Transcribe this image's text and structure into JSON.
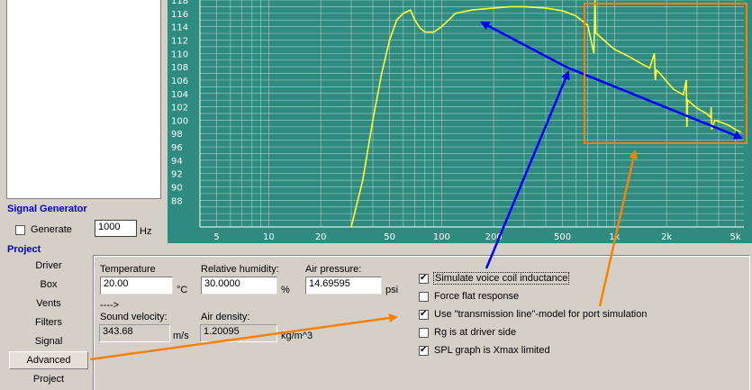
{
  "signal_generator": {
    "title": "Signal Generator",
    "generate_label": "Generate",
    "generate_checked": false,
    "frequency_value": "1000",
    "frequency_unit": "Hz"
  },
  "project_nav": {
    "title": "Project",
    "items": [
      "Driver",
      "Box",
      "Vents",
      "Filters",
      "Signal",
      "Advanced",
      "Project"
    ],
    "active": "Advanced"
  },
  "advanced": {
    "temperature": {
      "label": "Temperature",
      "value": "20.00",
      "unit": "°C"
    },
    "humidity": {
      "label": "Relative humidity:",
      "value": "30.0000",
      "unit": "%"
    },
    "pressure": {
      "label": "Air pressure:",
      "value": "14.69595",
      "unit": "psi"
    },
    "arrow_text": "---->",
    "sound_velocity": {
      "label": "Sound velocity:",
      "value": "343.68",
      "unit": "m/s"
    },
    "air_density": {
      "label": "Air density:",
      "value": "1.20095",
      "unit": "kg/m^3"
    },
    "options": [
      {
        "label": "Simulate voice coil inductance",
        "checked": true
      },
      {
        "label": "Force flat response",
        "checked": false
      },
      {
        "label": "Use \"transmission line\"-model for port simulation",
        "checked": true
      },
      {
        "label": "Rg is at driver side",
        "checked": false
      },
      {
        "label": "SPL graph is Xmax limited",
        "checked": true
      }
    ]
  },
  "colors": {
    "chart_bg": "#2f8a7f",
    "grid": "#a9d7cf",
    "curve": "#ffff33",
    "blue_annotation": "#0000ff",
    "orange_annotation": "#ff8000",
    "section_title": "#0000c0"
  },
  "chart_data": {
    "type": "line",
    "x_scale": "log",
    "xlim": [
      4,
      5600
    ],
    "ylim": [
      84,
      118
    ],
    "x_tick_labels": [
      "5",
      "10",
      "20",
      "50",
      "100",
      "200",
      "500",
      "1k",
      "2k",
      "5k"
    ],
    "x_tick_values": [
      5,
      10,
      20,
      50,
      100,
      200,
      500,
      1000,
      2000,
      5000
    ],
    "y_tick_labels": [
      "118",
      "116",
      "114",
      "112",
      "110",
      "108",
      "106",
      "104",
      "102",
      "100",
      "98",
      "96",
      "94",
      "92",
      "90",
      "88"
    ],
    "y_tick_values": [
      118,
      116,
      114,
      112,
      110,
      108,
      106,
      104,
      102,
      100,
      98,
      96,
      94,
      92,
      90,
      88
    ],
    "series": [
      {
        "x": [
          30,
          35,
          40,
          45,
          50,
          55,
          60,
          66,
          70,
          75,
          80,
          90,
          100,
          110,
          120,
          150,
          200,
          250,
          300,
          400,
          500,
          600,
          700,
          760,
          770,
          780,
          800,
          850,
          900,
          1000,
          1200,
          1400,
          1600,
          1700,
          1720,
          1750,
          1800,
          2000,
          2200,
          2500,
          2600,
          2620,
          2650,
          2700,
          3000,
          3400,
          3600,
          3620,
          3650,
          3800,
          4200,
          4600,
          5000,
          5400
        ],
        "y": [
          84,
          91,
          100,
          107,
          112,
          115,
          116,
          116.5,
          115,
          113.8,
          113.2,
          113.2,
          114,
          115,
          116,
          116.5,
          116.8,
          117,
          117,
          116.8,
          116.4,
          115.6,
          114.2,
          110,
          118,
          113,
          112.8,
          112.2,
          111.6,
          110.6,
          109.6,
          108.6,
          107.8,
          110,
          106,
          107.5,
          107.2,
          105.8,
          104.6,
          103.8,
          106,
          99,
          103,
          102.8,
          101.8,
          101,
          100.4,
          102,
          98.6,
          100,
          99.6,
          99.2,
          98.6,
          98.2
        ]
      }
    ],
    "annotations": [
      {
        "type": "arrow",
        "color": "blue"
      },
      {
        "type": "rectangle",
        "color": "orange"
      },
      {
        "type": "arrow",
        "color": "orange"
      }
    ]
  }
}
